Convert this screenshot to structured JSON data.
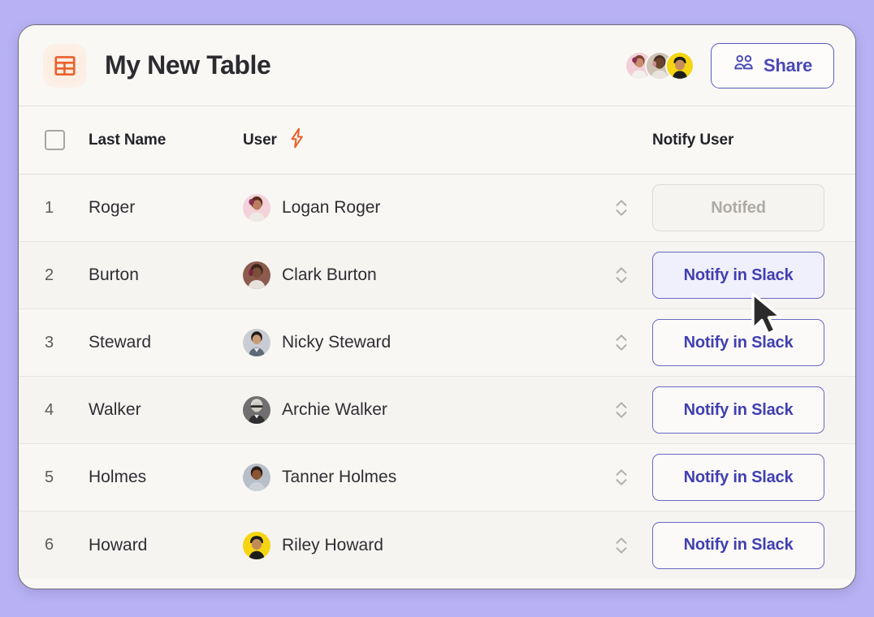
{
  "page": {
    "background_color": "#b8b2f5",
    "card_background": "#faf8f5"
  },
  "header": {
    "title": "My New Table",
    "table_icon": "table-grid-icon",
    "icon_color": "#e8622c",
    "share": {
      "label": "Share",
      "icon": "people-group-icon",
      "accent_color": "#4a49b5"
    },
    "collaborators": [
      {
        "name": "collaborator-1",
        "bg": "#f2cfd6"
      },
      {
        "name": "collaborator-2",
        "bg": "#cdc2b4"
      },
      {
        "name": "collaborator-3",
        "bg": "#f5d511"
      }
    ]
  },
  "table": {
    "columns": [
      {
        "key": "select",
        "label": "",
        "icon": "checkbox-icon"
      },
      {
        "key": "last_name",
        "label": "Last Name"
      },
      {
        "key": "user",
        "label": "User",
        "icon": "lightning-bolt-icon"
      },
      {
        "key": "sort",
        "label": ""
      },
      {
        "key": "notify_user",
        "label": "Notify User"
      }
    ],
    "rows": [
      {
        "index": "1",
        "last_name": "Roger",
        "user_name": "Logan Roger",
        "avatar_bg": "#f3d3d9",
        "action_label": "Notifed",
        "action_state": "done"
      },
      {
        "index": "2",
        "last_name": "Burton",
        "user_name": "Clark Burton",
        "avatar_bg": "#8c5b4e",
        "action_label": "Notify in Slack",
        "action_state": "hovered"
      },
      {
        "index": "3",
        "last_name": "Steward",
        "user_name": "Nicky Steward",
        "avatar_bg": "#c9ccd2",
        "action_label": "Notify in Slack",
        "action_state": "default"
      },
      {
        "index": "4",
        "last_name": "Walker",
        "user_name": "Archie Walker",
        "avatar_bg": "#6f6f70",
        "action_label": "Notify in Slack",
        "action_state": "default"
      },
      {
        "index": "5",
        "last_name": "Holmes",
        "user_name": "Tanner Holmes",
        "avatar_bg": "#b9bfc9",
        "action_label": "Notify in Slack",
        "action_state": "default"
      },
      {
        "index": "6",
        "last_name": "Howard",
        "user_name": "Riley Howard",
        "avatar_bg": "#f5d511",
        "action_label": "Notify in Slack",
        "action_state": "default"
      }
    ],
    "sort_icon": "sort-updown-chevrons-icon",
    "button_accent": "#413fb0"
  },
  "cursor": {
    "icon": "mouse-arrow-pointer"
  }
}
